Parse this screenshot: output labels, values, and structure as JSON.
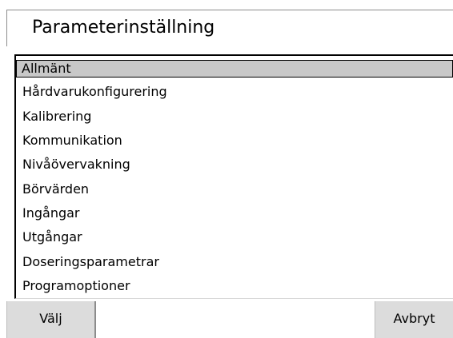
{
  "header": {
    "title": "Parameterinställning"
  },
  "menu": {
    "items": [
      {
        "label": "Allmänt",
        "selected": true
      },
      {
        "label": "Hårdvarukonfigurering",
        "selected": false
      },
      {
        "label": "Kalibrering",
        "selected": false
      },
      {
        "label": "Kommunikation",
        "selected": false
      },
      {
        "label": "Nivåövervakning",
        "selected": false
      },
      {
        "label": "Börvärden",
        "selected": false
      },
      {
        "label": "Ingångar",
        "selected": false
      },
      {
        "label": "Utgångar",
        "selected": false
      },
      {
        "label": "Doseringsparametrar",
        "selected": false
      },
      {
        "label": "Programoptioner",
        "selected": false
      }
    ]
  },
  "footer": {
    "select_label": "Välj",
    "cancel_label": "Avbryt"
  },
  "colors": {
    "background": "#ffffff",
    "selection": "#c8c8c8",
    "button": "#dcdcdc",
    "text": "#000000"
  }
}
